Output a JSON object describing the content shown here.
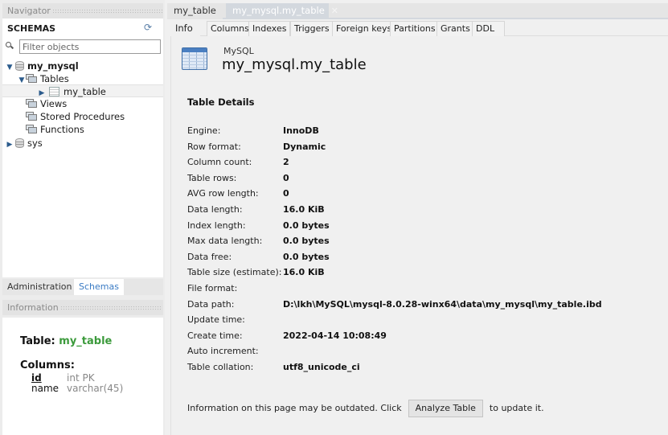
{
  "navigator": {
    "header": "Navigator",
    "schemas_title": "SCHEMAS",
    "filter_placeholder": "Filter objects",
    "tree": {
      "schema1": "my_mysql",
      "tables_folder": "Tables",
      "table1": "my_table",
      "views_folder": "Views",
      "procedures_folder": "Stored Procedures",
      "functions_folder": "Functions",
      "schema2": "sys"
    },
    "bottom_tabs": [
      "Administration",
      "Schemas"
    ],
    "active_bottom_tab": "Schemas"
  },
  "information": {
    "header": "Information",
    "table_label": "Table:",
    "table_name": "my_table",
    "columns_label": "Columns:",
    "columns": [
      {
        "name": "id",
        "type": "int PK"
      },
      {
        "name": "name",
        "type": "varchar(45)"
      }
    ]
  },
  "editor": {
    "doc_tabs": [
      "my_table",
      "my_mysql.my_table"
    ],
    "active_doc_tab": "my_mysql.my_table",
    "sub_tabs": [
      "Info",
      "Columns",
      "Indexes",
      "Triggers",
      "Foreign keys",
      "Partitions",
      "Grants",
      "DDL"
    ],
    "active_sub_tab": "Info",
    "kind": "MySQL",
    "heading": "my_mysql.my_table",
    "section_title": "Table Details",
    "details": [
      {
        "label": "Engine:",
        "value": "InnoDB"
      },
      {
        "label": "Row format:",
        "value": "Dynamic"
      },
      {
        "label": "Column count:",
        "value": "2"
      },
      {
        "label": "Table rows:",
        "value": "0"
      },
      {
        "label": "AVG row length:",
        "value": "0"
      },
      {
        "label": "Data length:",
        "value": "16.0 KiB"
      },
      {
        "label": "Index length:",
        "value": "0.0 bytes"
      },
      {
        "label": "Max data length:",
        "value": "0.0 bytes"
      },
      {
        "label": "Data free:",
        "value": "0.0 bytes"
      },
      {
        "label": "Table size (estimate):",
        "value": "16.0 KiB"
      },
      {
        "label": "File format:",
        "value": ""
      },
      {
        "label": "Data path:",
        "value": "D:\\lkh\\MySQL\\mysql-8.0.28-winx64\\data\\my_mysql\\my_table.ibd"
      },
      {
        "label": "Update time:",
        "value": ""
      },
      {
        "label": "Create time:",
        "value": "2022-04-14 10:08:49"
      },
      {
        "label": "Auto increment:",
        "value": ""
      },
      {
        "label": "Table collation:",
        "value": "utf8_unicode_ci"
      }
    ],
    "footer_before": "Information on this page may be outdated. Click",
    "analyze_button": "Analyze Table",
    "footer_after": "to update it."
  }
}
